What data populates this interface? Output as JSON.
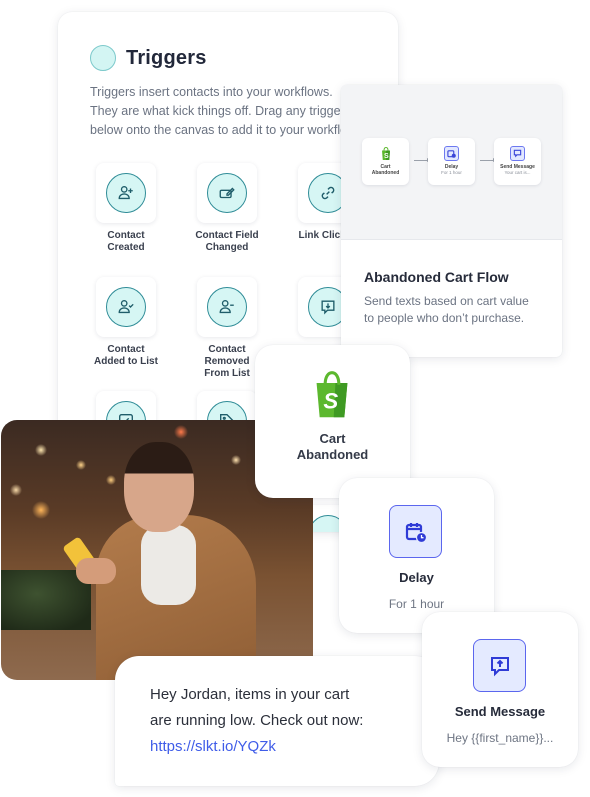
{
  "triggers": {
    "title": "Triggers",
    "description_lines": [
      "Triggers insert contacts into your workflows.",
      "They are what kick things off. Drag any trigger",
      "below onto the canvas to add it to your workflow."
    ],
    "items": [
      {
        "label_1": "Contact",
        "label_2": "Created",
        "icon": "user-plus-icon"
      },
      {
        "label_1": "Contact Field",
        "label_2": "Changed",
        "icon": "edit-field-icon"
      },
      {
        "label_1": "Link Clicked",
        "label_2": "",
        "icon": "link-icon"
      },
      {
        "label_1": "Contact",
        "label_2": "Added to List",
        "icon": "user-check-icon"
      },
      {
        "label_1": "Contact",
        "label_2": "Removed",
        "label_3": "From List",
        "icon": "user-minus-icon"
      },
      {
        "label_1": "",
        "label_2": "",
        "icon": "message-download-icon"
      },
      {
        "icon": "edit-box-icon"
      },
      {
        "icon": "tag-icon"
      }
    ]
  },
  "flow_card": {
    "title": "Abandoned Cart Flow",
    "description_lines": [
      "Send texts based on cart value",
      "to people who don’t purchase."
    ],
    "mini_nodes": [
      {
        "title_1": "Cart",
        "title_2": "Abandoned",
        "sub": ""
      },
      {
        "title_1": "Delay",
        "title_2": "",
        "sub": "For 1 hour"
      },
      {
        "title_1": "Send Message",
        "title_2": "",
        "sub": "Your cart is..."
      }
    ]
  },
  "cart_node": {
    "label_1": "Cart",
    "label_2": "Abandoned"
  },
  "delay_node": {
    "title": "Delay",
    "subtitle": "For 1 hour"
  },
  "send_node": {
    "title": "Send Message",
    "subtitle": "Hey {{first_name}}..."
  },
  "sms": {
    "line_1": "Hey Jordan, items in your cart",
    "line_2": "are running low. Check out now:",
    "link": "https://slkt.io/YQZk"
  },
  "colors": {
    "teal_ring": "#2f8c97",
    "teal_fill": "#d6f6f4",
    "accent_blue": "#5b66ee",
    "link_blue": "#3f5ce8",
    "shopify_green": "#5cb82e"
  }
}
